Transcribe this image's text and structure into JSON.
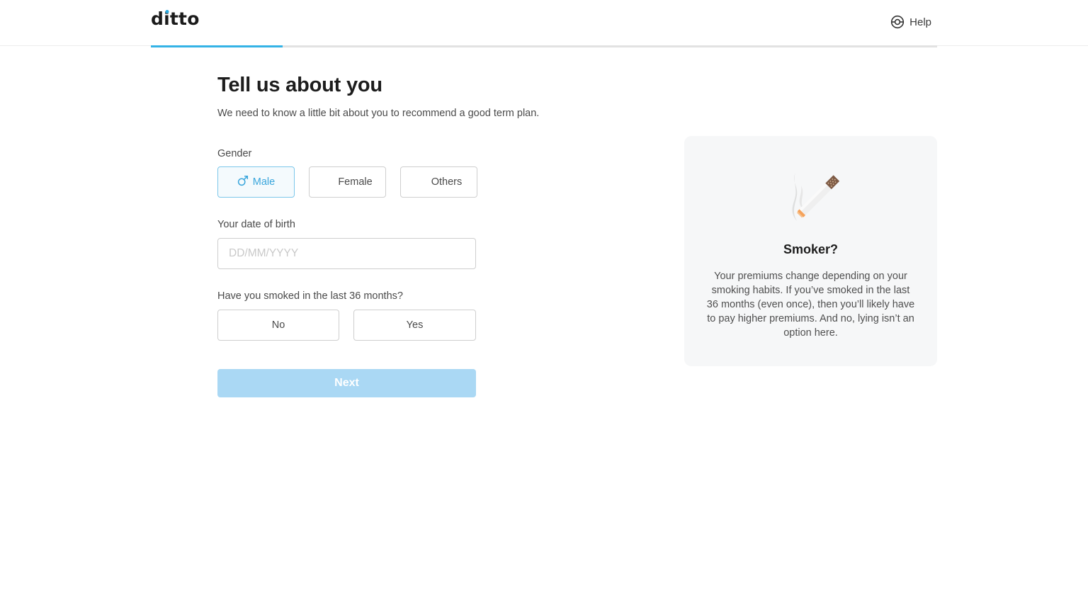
{
  "header": {
    "logo_text_before": "d",
    "logo_text_i": "i",
    "logo_text_after": "tto",
    "help_label": "Help",
    "progress_fraction": 0.168
  },
  "main": {
    "title": "Tell us about you",
    "subtitle": "We need to know a little bit about you to recommend a good term plan.",
    "gender": {
      "label": "Gender",
      "options": [
        "Male",
        "Female",
        "Others"
      ],
      "selected": "Male"
    },
    "dob": {
      "label": "Your date of birth",
      "placeholder": "DD/MM/YYYY",
      "value": ""
    },
    "smoke": {
      "label": "Have you smoked in the last 36 months?",
      "options": [
        "No",
        "Yes"
      ]
    },
    "next_label": "Next"
  },
  "info_card": {
    "title": "Smoker?",
    "body": "Your premiums change depending on your smoking habits. If you’ve smoked in the last 36 months (even once), then you’ll likely have to pay higher premiums. And no, lying isn’t an option here."
  },
  "colors": {
    "accent": "#34b3e6",
    "next_disabled": "#aad8f4",
    "card_bg": "#f6f7f8"
  },
  "icons": {
    "help": "lifebuoy-icon",
    "male": "male-symbol-icon",
    "card_illustration": "cigarette-illustration"
  }
}
